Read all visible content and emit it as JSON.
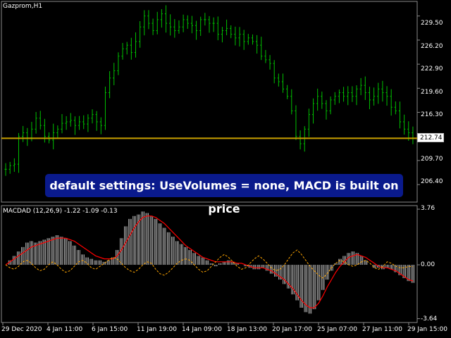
{
  "symbol_title": "Gazprom,H1",
  "last_price": "212.74",
  "banner_text": "default settings: UseVolumes = none, MACD is built on price",
  "price_axis": [
    "229.50",
    "226.20",
    "222.90",
    "219.60",
    "216.30",
    "209.70",
    "206.40"
  ],
  "indicator": {
    "title": "MACDAD (12,26,9) -1.22 -1.09 -0.13",
    "axis": [
      "3.76",
      "0.00",
      "-3.64"
    ]
  },
  "time_axis": [
    "29 Dec 2020",
    "4 Jan 11:00",
    "6 Jan 15:00",
    "11 Jan 19:00",
    "14 Jan 09:00",
    "18 Jan 13:00",
    "20 Jan 17:00",
    "25 Jan 07:00",
    "27 Jan 11:00",
    "29 Jan 15:00"
  ],
  "colors": {
    "background": "#000000",
    "candles": "#00c000",
    "horizontal_line": "#c8a000",
    "macd_histogram": "#c0c0c0",
    "signal_line": "#ff0000",
    "dashed_line": "#ffa500",
    "banner_bg": "#0a1a8c"
  },
  "chart_data": [
    {
      "type": "line",
      "series": [
        {
          "values": [
            208.5,
            209.0,
            209.2,
            213.0,
            213.5,
            212.8,
            214.0,
            215.5,
            214.5,
            213.0,
            212.5,
            213.5,
            214.0,
            214.8,
            215.0,
            215.2,
            214.5,
            215.0,
            214.7,
            215.5,
            216.0,
            215.0,
            214.5,
            219.0,
            221.0,
            222.0,
            224.0,
            225.0,
            225.5,
            224.5,
            226.0,
            228.0,
            229.5,
            228.5,
            227.5,
            229.0,
            229.8,
            228.5,
            228.0,
            227.5,
            228.0,
            229.0,
            228.5,
            228.2,
            227.5,
            229.0,
            229.0,
            228.5,
            228.5,
            227.0,
            227.5,
            227.8,
            227.0,
            226.5,
            227.0,
            226.0,
            226.5,
            226.0,
            225.5,
            224.0,
            223.5,
            223.0,
            221.0,
            220.5,
            219.5,
            218.5,
            216.5,
            213.0,
            212.0,
            214.0,
            216.0,
            217.5,
            218.5,
            217.5,
            216.5,
            218.0,
            218.5,
            219.0,
            218.5,
            219.0,
            218.5,
            219.5,
            220.0,
            219.0,
            218.0,
            218.5,
            219.5,
            219.0,
            218.5,
            217.0,
            216.5,
            215.0,
            214.0,
            213.5,
            212.74
          ]
        }
      ],
      "reference_line": 212.74,
      "y_axis_ticks": [
        229.5,
        226.2,
        222.9,
        219.6,
        216.3,
        209.7,
        206.4
      ],
      "x_tick_labels": [
        "29 Dec 2020",
        "4 Jan 11:00",
        "6 Jan 15:00",
        "11 Jan 19:00",
        "14 Jan 09:00",
        "18 Jan 13:00",
        "20 Jan 17:00",
        "25 Jan 07:00",
        "27 Jan 11:00",
        "29 Jan 15:00"
      ],
      "ylim": [
        204.0,
        231.5
      ]
    },
    {
      "type": "bar",
      "histogram": [
        0.0,
        0.3,
        0.6,
        0.9,
        1.2,
        1.5,
        1.6,
        1.5,
        1.6,
        1.7,
        1.8,
        1.9,
        2.0,
        1.9,
        1.8,
        1.6,
        1.3,
        1.0,
        0.7,
        0.5,
        0.4,
        0.3,
        0.3,
        0.2,
        0.3,
        0.5,
        1.0,
        1.8,
        2.6,
        3.1,
        3.3,
        3.4,
        3.6,
        3.5,
        3.3,
        3.1,
        2.8,
        2.5,
        2.2,
        1.9,
        1.6,
        1.4,
        1.2,
        1.0,
        0.8,
        0.6,
        0.5,
        0.3,
        0.1,
        -0.1,
        0.1,
        0.2,
        0.3,
        0.2,
        0.1,
        0.0,
        -0.1,
        -0.2,
        -0.3,
        -0.3,
        -0.2,
        -0.4,
        -0.6,
        -0.8,
        -1.0,
        -1.3,
        -1.6,
        -2.0,
        -2.4,
        -2.9,
        -3.2,
        -3.3,
        -3.0,
        -2.4,
        -1.7,
        -1.0,
        -0.4,
        0.1,
        0.4,
        0.6,
        0.8,
        0.9,
        0.8,
        0.6,
        0.3,
        0.0,
        -0.2,
        -0.2,
        -0.3,
        -0.2,
        -0.3,
        -0.5,
        -0.7,
        -0.9,
        -1.1,
        -1.22
      ],
      "signal": [
        0.0,
        0.2,
        0.4,
        0.6,
        0.8,
        1.0,
        1.2,
        1.3,
        1.4,
        1.5,
        1.6,
        1.7,
        1.8,
        1.8,
        1.8,
        1.7,
        1.6,
        1.4,
        1.2,
        1.0,
        0.8,
        0.6,
        0.5,
        0.4,
        0.4,
        0.4,
        0.6,
        1.0,
        1.5,
        2.0,
        2.5,
        2.9,
        3.2,
        3.3,
        3.3,
        3.2,
        3.0,
        2.8,
        2.5,
        2.2,
        1.9,
        1.6,
        1.3,
        1.1,
        0.9,
        0.7,
        0.5,
        0.4,
        0.3,
        0.2,
        0.2,
        0.2,
        0.2,
        0.2,
        0.1,
        0.1,
        0.0,
        -0.1,
        -0.2,
        -0.2,
        -0.2,
        -0.3,
        -0.4,
        -0.6,
        -0.8,
        -1.0,
        -1.3,
        -1.6,
        -2.0,
        -2.4,
        -2.7,
        -2.9,
        -2.9,
        -2.6,
        -2.1,
        -1.5,
        -1.0,
        -0.5,
        -0.1,
        0.2,
        0.5,
        0.6,
        0.7,
        0.6,
        0.5,
        0.3,
        0.1,
        -0.1,
        -0.2,
        -0.2,
        -0.3,
        -0.4,
        -0.6,
        -0.8,
        -1.0,
        -1.09
      ],
      "dashed": [
        0.0,
        -0.2,
        -0.3,
        -0.1,
        0.2,
        0.3,
        0.1,
        -0.2,
        -0.4,
        -0.3,
        0.0,
        0.2,
        0.0,
        -0.3,
        -0.5,
        -0.4,
        -0.1,
        0.2,
        0.3,
        0.1,
        -0.2,
        -0.3,
        -0.1,
        0.1,
        0.3,
        0.5,
        0.4,
        0.1,
        -0.2,
        -0.4,
        -0.5,
        -0.3,
        0.0,
        0.2,
        0.1,
        -0.3,
        -0.6,
        -0.7,
        -0.5,
        -0.2,
        0.1,
        0.3,
        0.4,
        0.3,
        0.0,
        -0.3,
        -0.5,
        -0.4,
        -0.1,
        0.2,
        0.5,
        0.7,
        0.5,
        0.2,
        -0.1,
        -0.3,
        -0.2,
        0.1,
        0.4,
        0.6,
        0.4,
        0.1,
        -0.2,
        -0.4,
        -0.3,
        0.0,
        0.4,
        0.8,
        1.0,
        0.7,
        0.3,
        -0.1,
        -0.4,
        -0.7,
        -0.9,
        -0.6,
        -0.2,
        0.1,
        0.3,
        0.2,
        0.0,
        -0.1,
        0.0,
        0.2,
        0.3,
        0.1,
        -0.2,
        -0.3,
        -0.1,
        0.2,
        0.1,
        -0.1,
        -0.2,
        -0.2,
        -0.1,
        -0.13
      ],
      "y_axis_ticks": [
        3.76,
        0.0,
        -3.64
      ],
      "ylim": [
        -3.9,
        4.0
      ]
    }
  ]
}
